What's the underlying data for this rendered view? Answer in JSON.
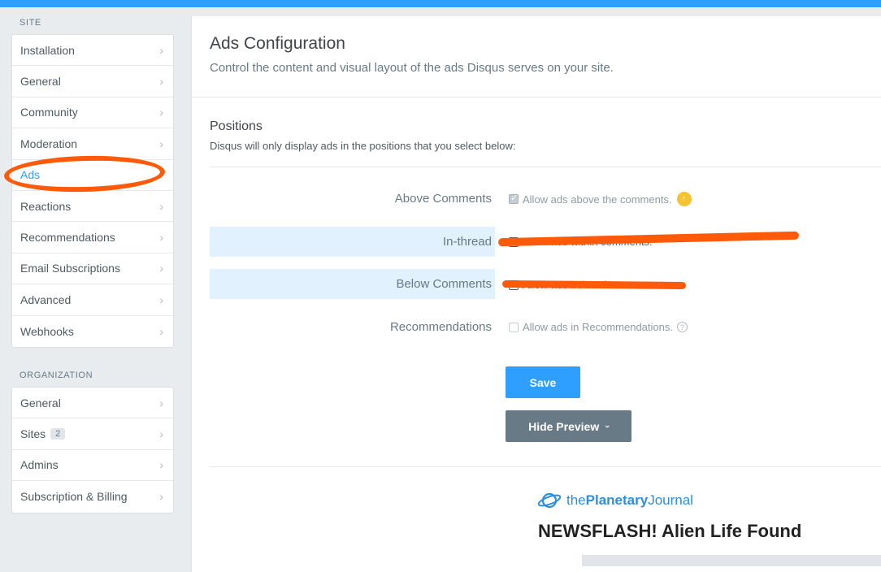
{
  "sidebar": {
    "site_label": "SITE",
    "site_items": [
      {
        "label": "Installation"
      },
      {
        "label": "General"
      },
      {
        "label": "Community"
      },
      {
        "label": "Moderation"
      },
      {
        "label": "Ads",
        "active": true
      },
      {
        "label": "Reactions"
      },
      {
        "label": "Recommendations"
      },
      {
        "label": "Email Subscriptions"
      },
      {
        "label": "Advanced"
      },
      {
        "label": "Webhooks"
      }
    ],
    "org_label": "ORGANIZATION",
    "org_items": [
      {
        "label": "General"
      },
      {
        "label": "Sites",
        "badge": "2"
      },
      {
        "label": "Admins"
      },
      {
        "label": "Subscription & Billing"
      }
    ]
  },
  "main": {
    "title": "Ads Configuration",
    "subtitle": "Control the content and visual layout of the ads Disqus serves on your site.",
    "positions": {
      "title": "Positions",
      "subtitle": "Disqus will only display ads in the positions that you select below:",
      "rows": [
        {
          "label": "Above Comments",
          "option": "Allow ads above the comments.",
          "checked": true,
          "disabled": true
        },
        {
          "label": "In-thread",
          "option": "Allow ads within comments.",
          "checked": false
        },
        {
          "label": "Below Comments",
          "option": "Allow ads below the comments.",
          "checked": false
        },
        {
          "label": "Recommendations",
          "option": "Allow ads in Recommendations.",
          "checked": false,
          "disabled": true
        }
      ]
    },
    "save_label": "Save",
    "hide_preview_label": "Hide Preview",
    "preview": {
      "logo_prefix": "the",
      "logo_bold": "Planetary",
      "logo_suffix": "Journal",
      "headline": "NEWSFLASH! Alien Life Found"
    }
  },
  "colors": {
    "accent": "#2e9fff",
    "annotation": "#ff5a0a",
    "highlight_row": "#e1f1fd",
    "preview_button": "#687a86"
  }
}
